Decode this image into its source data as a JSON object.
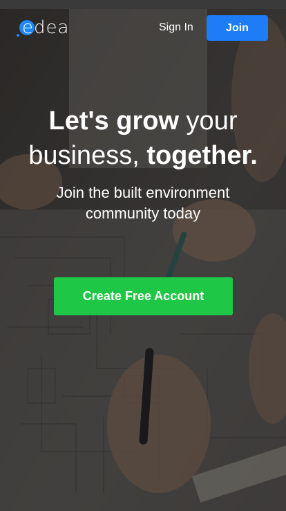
{
  "header": {
    "logo_text": "edea",
    "signin_label": "Sign In",
    "join_label": "Join"
  },
  "hero": {
    "headline_bold_1": "Let's grow",
    "headline_plain_1": " your",
    "headline_plain_2": "business, ",
    "headline_bold_2": "together.",
    "subline": "Join the built environment community today"
  },
  "cta": {
    "label": "Create Free Account"
  },
  "colors": {
    "brand_blue": "#1e7cf7",
    "cta_green": "#1ec846",
    "overlay": "#1e1e1e"
  },
  "icons": {
    "background": "blueprint-photo"
  }
}
